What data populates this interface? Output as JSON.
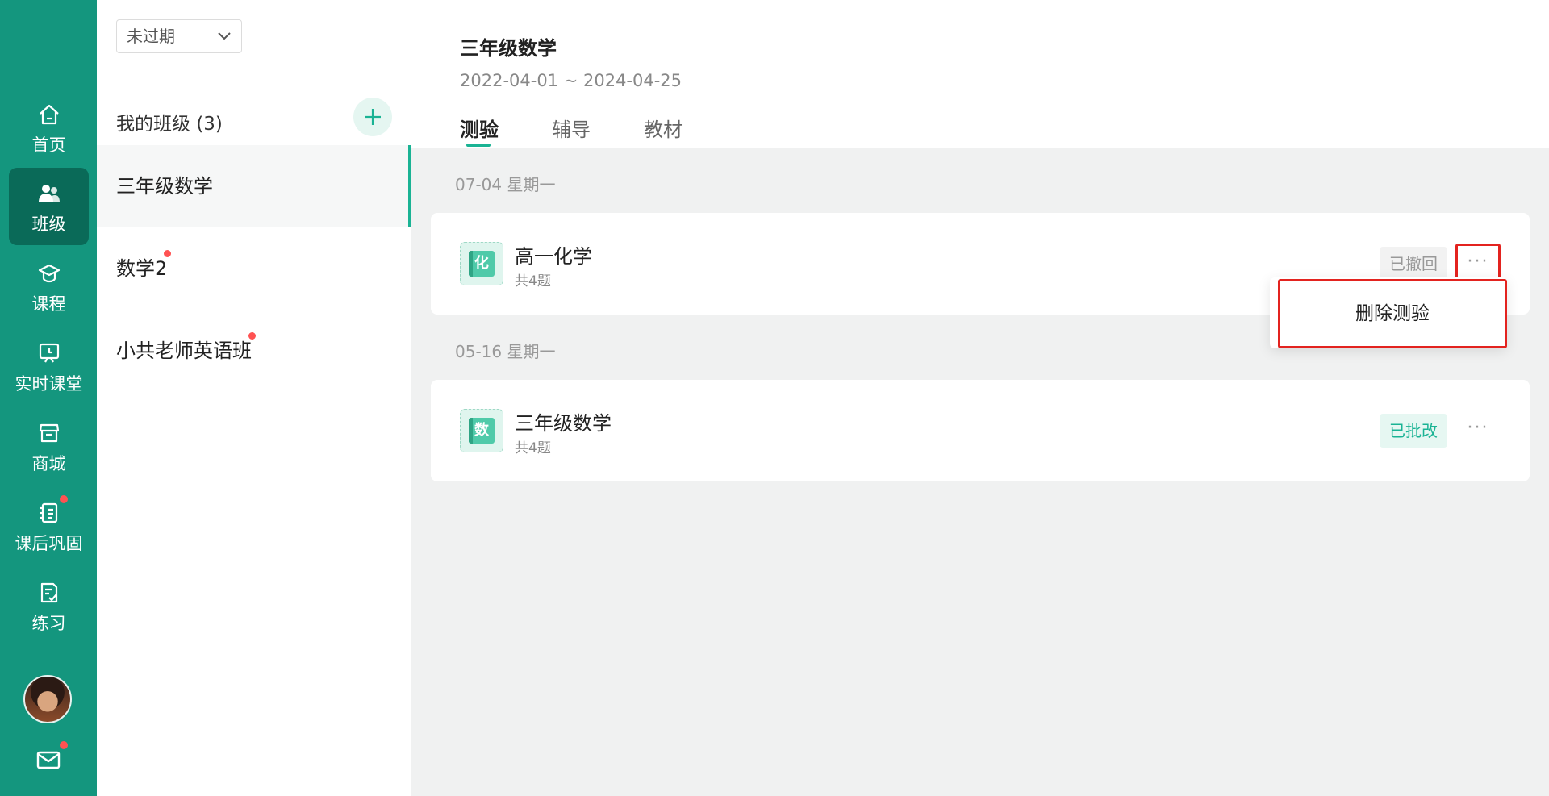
{
  "nav": {
    "items": [
      {
        "label": "首页",
        "icon": "home-icon"
      },
      {
        "label": "班级",
        "icon": "class-icon"
      },
      {
        "label": "课程",
        "icon": "course-icon"
      },
      {
        "label": "实时课堂",
        "icon": "live-classroom-icon"
      },
      {
        "label": "商城",
        "icon": "store-icon"
      },
      {
        "label": "课后巩固",
        "icon": "homework-icon"
      },
      {
        "label": "练习",
        "icon": "practice-icon"
      }
    ],
    "active_index": 1
  },
  "classes_panel": {
    "filter_value": "未过期",
    "title": "我的班级 (3)",
    "items": [
      {
        "label": "三年级数学",
        "active": true,
        "has_dot": false
      },
      {
        "label": "数学2",
        "active": false,
        "has_dot": true
      },
      {
        "label": "小共老师英语班",
        "active": false,
        "has_dot": true
      }
    ]
  },
  "header": {
    "title": "三年级数学",
    "date_range": "2022-04-01 ~ 2024-04-25",
    "tabs": [
      "测验",
      "辅导",
      "教材"
    ],
    "active_tab": 0
  },
  "groups": [
    {
      "date": "07-04 星期一",
      "card": {
        "icon_char": "化",
        "title": "高一化学",
        "subtitle": "共4题",
        "status": "已撤回",
        "status_style": "gray"
      }
    },
    {
      "date": "05-16 星期一",
      "card": {
        "icon_char": "数",
        "title": "三年级数学",
        "subtitle": "共4题",
        "status": "已批改",
        "status_style": "green"
      }
    }
  ],
  "more_label": "···",
  "dropdown": {
    "delete_label": "删除测验"
  },
  "colors": {
    "brand": "#14967e",
    "accent": "#1ab394",
    "highlight": "#e3231f",
    "badge": "#ff5252"
  }
}
